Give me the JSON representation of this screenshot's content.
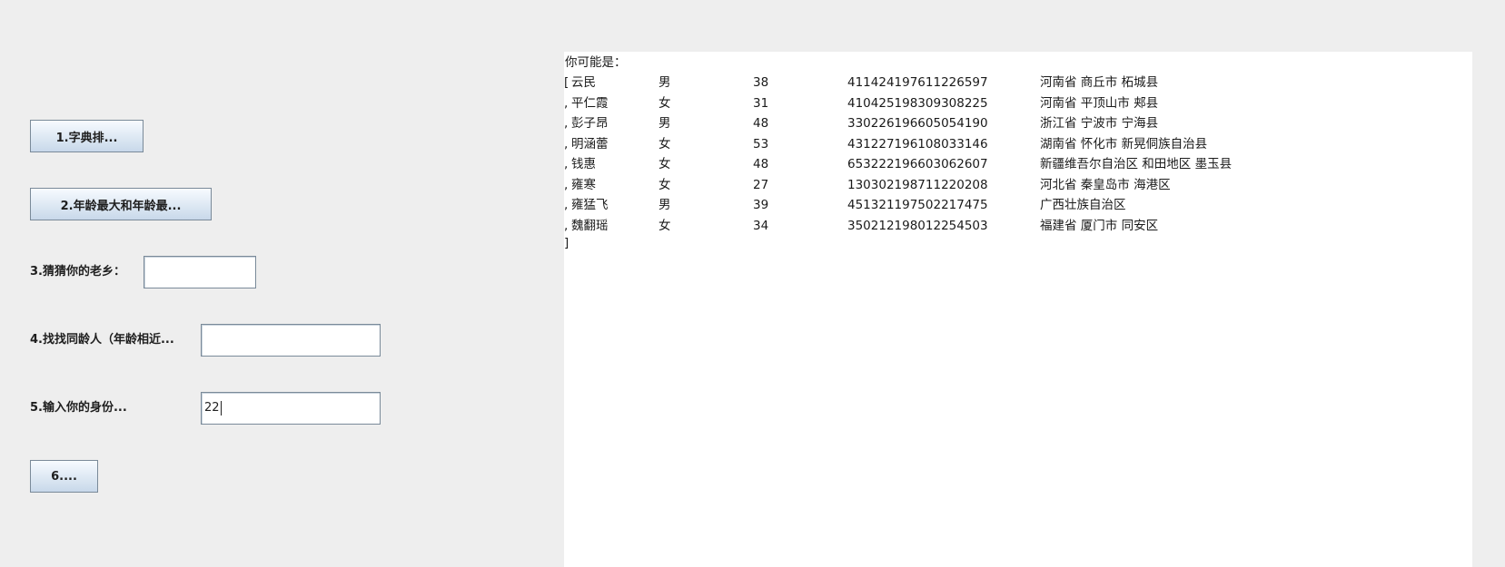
{
  "left_panel": {
    "buttons": {
      "sort": "1.字典排...",
      "age_extremes": "2.年龄最大和年龄最...",
      "six": "6...."
    },
    "labels": {
      "guess_hometown": "3.猜猜你的老乡：",
      "find_same_age": "4.找找同龄人（年龄相近...",
      "input_id": "5.输入你的身份..."
    },
    "inputs": {
      "guess_hometown_value": "",
      "find_same_age_value": "",
      "input_id_value": "22"
    }
  },
  "result": {
    "heading": "你可能是：",
    "open_bracket": "[",
    "close_bracket": "]",
    "separator": ",",
    "rows": [
      {
        "name": "云民",
        "gender": "男",
        "age": "38",
        "id": "411424197611226597",
        "address": "河南省 商丘市 柘城县"
      },
      {
        "name": "平仁霞",
        "gender": "女",
        "age": "31",
        "id": "410425198309308225",
        "address": "河南省 平顶山市 郏县"
      },
      {
        "name": "彭子昂",
        "gender": "男",
        "age": "48",
        "id": "330226196605054190",
        "address": "浙江省 宁波市 宁海县"
      },
      {
        "name": "明涵蕾",
        "gender": "女",
        "age": "53",
        "id": "431227196108033146",
        "address": "湖南省 怀化市 新晃侗族自治县"
      },
      {
        "name": "钱惠",
        "gender": "女",
        "age": "48",
        "id": "653222196603062607",
        "address": "新疆维吾尔自治区 和田地区 墨玉县"
      },
      {
        "name": "雍寒",
        "gender": "女",
        "age": "27",
        "id": "130302198711220208",
        "address": "河北省 秦皇岛市 海港区"
      },
      {
        "name": "雍猛飞",
        "gender": "男",
        "age": "39",
        "id": "451321197502217475",
        "address": "广西壮族自治区"
      },
      {
        "name": "魏翻瑶",
        "gender": "女",
        "age": "34",
        "id": "350212198012254503",
        "address": "福建省 厦门市 同安区"
      }
    ]
  }
}
